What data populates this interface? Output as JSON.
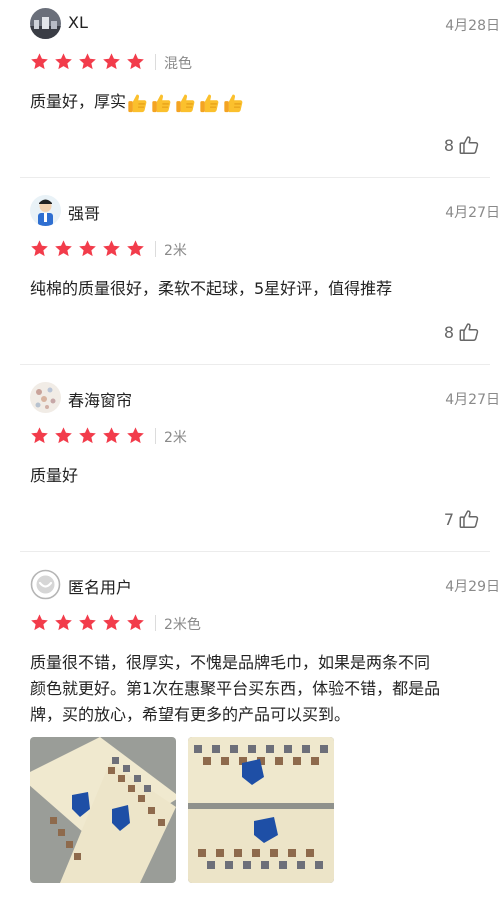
{
  "reviews": [
    {
      "user": "XL",
      "date": "4月28日",
      "rating": 5,
      "spec": "混色",
      "content": "质量好，厚实",
      "thumbs_emoji_count": 5,
      "likes": "8"
    },
    {
      "user": "强哥",
      "date": "4月27日",
      "rating": 5,
      "spec": "2米",
      "content": "纯棉的质量很好，柔软不起球，5星好评，值得推荐",
      "likes": "8"
    },
    {
      "user": "春海窗帘",
      "date": "4月27日",
      "rating": 5,
      "spec": "2米",
      "content": "质量好",
      "likes": "7"
    },
    {
      "user": "匿名用户",
      "date": "4月29日",
      "rating": 5,
      "spec": "2米色",
      "content_line1": "质量很不错，很厚实，不愧是品牌毛巾，如果是两条不同",
      "content_line2": "颜色就更好。第1次在惠聚平台买东西，体验不错，都是品",
      "content_line3": "牌，买的放心，希望有更多的产品可以买到。",
      "photos": [
        "towel-photo-1",
        "towel-photo-2"
      ]
    }
  ],
  "colors": {
    "star": "#f23c4b",
    "muted": "#8a8a8a",
    "divider": "#ececec"
  }
}
